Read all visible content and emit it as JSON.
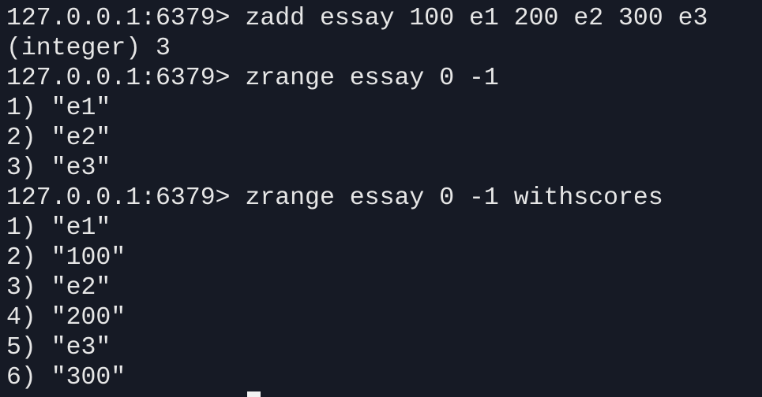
{
  "terminal": {
    "lines": [
      "127.0.0.1:6379> zadd essay 100 e1 200 e2 300 e3",
      "(integer) 3",
      "127.0.0.1:6379> zrange essay 0 -1",
      "1) \"e1\"",
      "2) \"e2\"",
      "3) \"e3\"",
      "127.0.0.1:6379> zrange essay 0 -1 withscores",
      "1) \"e1\"",
      "2) \"100\"",
      "3) \"e2\"",
      "4) \"200\"",
      "5) \"e3\"",
      "6) \"300\""
    ]
  },
  "colors": {
    "background": "#161a25",
    "text": "#e6e6e6",
    "cursor": "#f2f2f2"
  }
}
